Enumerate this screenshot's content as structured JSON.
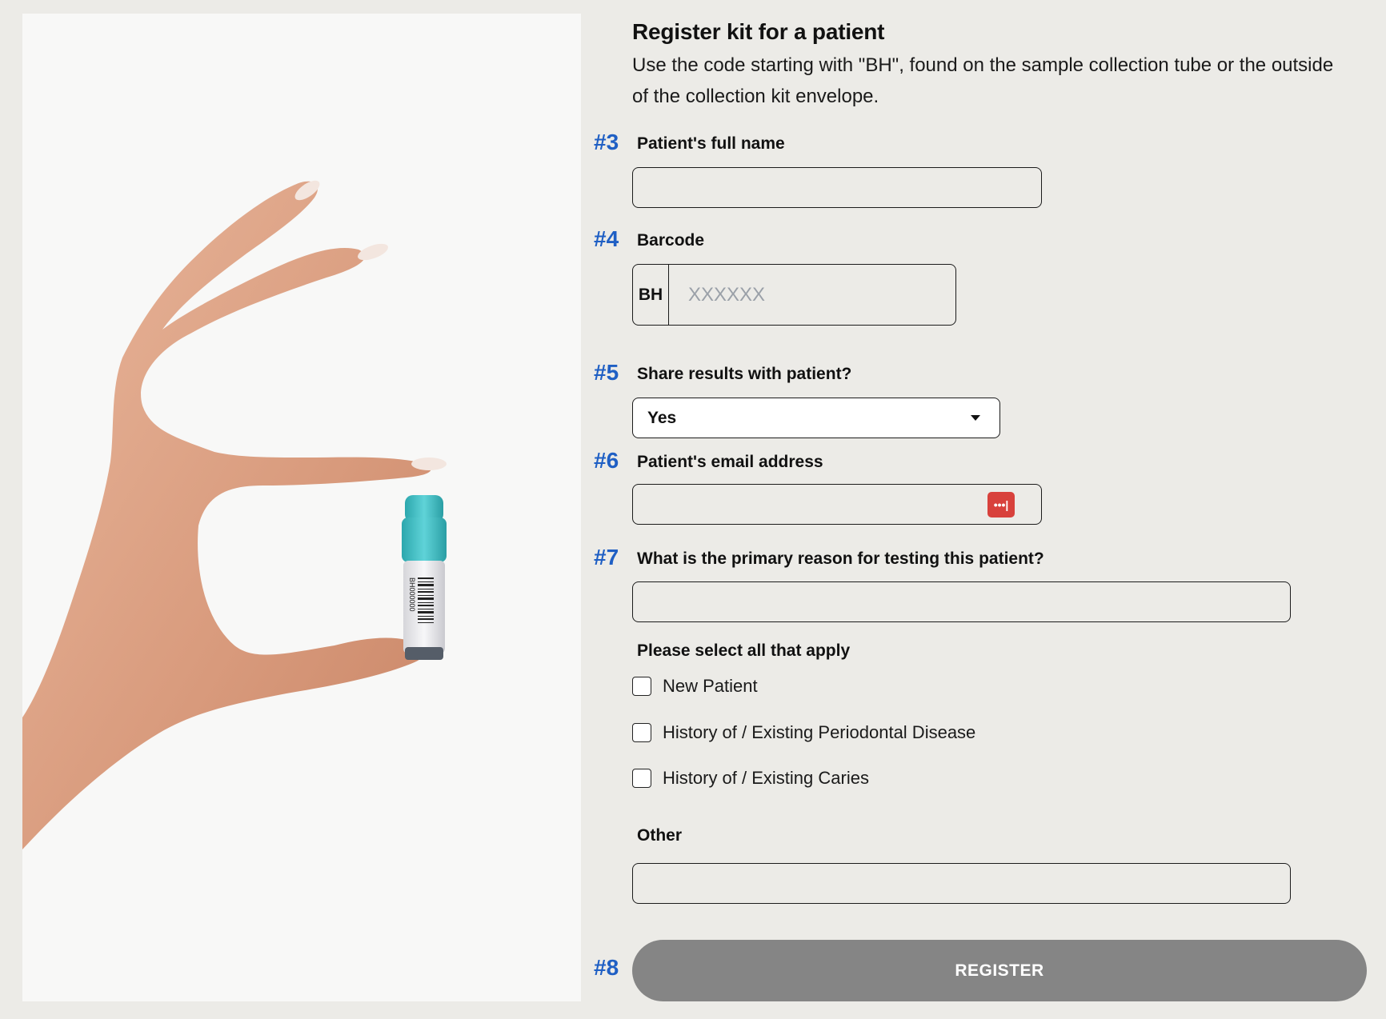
{
  "form": {
    "title": "Register kit for a patient",
    "subtitle": "Use the code starting with \"BH\", found on the sample collection tube or the outside of the collection kit envelope.",
    "step3": {
      "number": "#3",
      "label": "Patient's full name",
      "value": ""
    },
    "step4": {
      "number": "#4",
      "label": "Barcode",
      "prefix": "BH",
      "placeholder": "XXXXXX",
      "value": ""
    },
    "step5": {
      "number": "#5",
      "label": "Share results with patient?",
      "selected": "Yes"
    },
    "step6": {
      "number": "#6",
      "label": "Patient's email address",
      "value": "",
      "password_manager_icon_text": "•••|"
    },
    "step7": {
      "number": "#7",
      "label": "What is the primary reason for testing this patient?",
      "value": "",
      "select_all_label": "Please select all that apply",
      "options": [
        {
          "label": "New Patient",
          "checked": false
        },
        {
          "label": "History of / Existing Periodontal Disease",
          "checked": false
        },
        {
          "label": "History of / Existing Caries",
          "checked": false
        }
      ],
      "other_label": "Other",
      "other_value": ""
    },
    "step8": {
      "number": "#8",
      "button_label": "REGISTER"
    }
  },
  "image": {
    "tube_label_text": "BH000000"
  },
  "icons": {
    "select_caret": "caret-down-icon",
    "password_manager": "password-manager-icon"
  },
  "colors": {
    "step_number": "#1f5fc4",
    "register_button": "#858585",
    "password_icon": "#d8413c",
    "background": "#ecebe7",
    "image_panel": "#f8f8f7",
    "tube_cap": "#3bbfc6"
  }
}
